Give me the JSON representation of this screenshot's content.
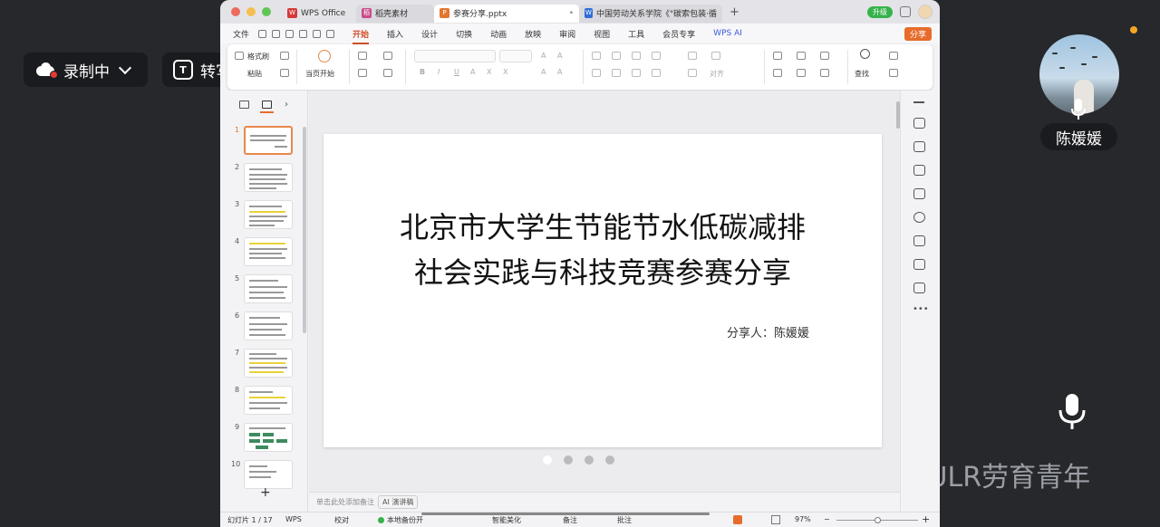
{
  "meeting": {
    "recording_label": "录制中",
    "transcribe_label": "转写中",
    "participant_name": "陈媛媛"
  },
  "watermark": "公众号 · CULR劳育青年",
  "tabs": [
    {
      "label": "WPS Office",
      "color": "#d63a3a"
    },
    {
      "label": "稻壳素材",
      "color": "#c94b8b"
    },
    {
      "label": "参赛分享.pptx",
      "color": "#e2762f"
    },
    {
      "label": "中国劳动关系学院《\"碳索包装·循",
      "color": "#2f6ed8"
    }
  ],
  "upgrade_label": "升级",
  "share_label": "分享",
  "menu": {
    "file": "文件",
    "items": [
      "开始",
      "插入",
      "设计",
      "切换",
      "动画",
      "放映",
      "审阅",
      "视图",
      "工具",
      "会员专享",
      "WPS AI"
    ],
    "active": "开始"
  },
  "ribbon": {
    "format_painter": "格式刷",
    "paste": "粘贴",
    "play_from_current": "当页开始",
    "align": "对齐",
    "find": "查找"
  },
  "slides": {
    "current": 1,
    "total": 17,
    "count_visible": 10
  },
  "slide_content": {
    "title_line1": "北京市大学生节能节水低碳减排",
    "title_line2": "社会实践与科技竞赛参赛分享",
    "presenter": "分享人：陈媛媛"
  },
  "notes": {
    "placeholder": "单击此处添加备注",
    "ai_label": "AI 演讲稿"
  },
  "status": {
    "slide_info": "幻灯片 1 / 17",
    "theme": "WPS",
    "proofread": "校对",
    "backup": "本地备份开",
    "beautify": "智能美化",
    "notes": "备注",
    "comments": "批注",
    "zoom": "97%"
  },
  "colors": {
    "accent": "#e76c2c",
    "active_tab": "#d0502a",
    "green": "#35b34a"
  }
}
